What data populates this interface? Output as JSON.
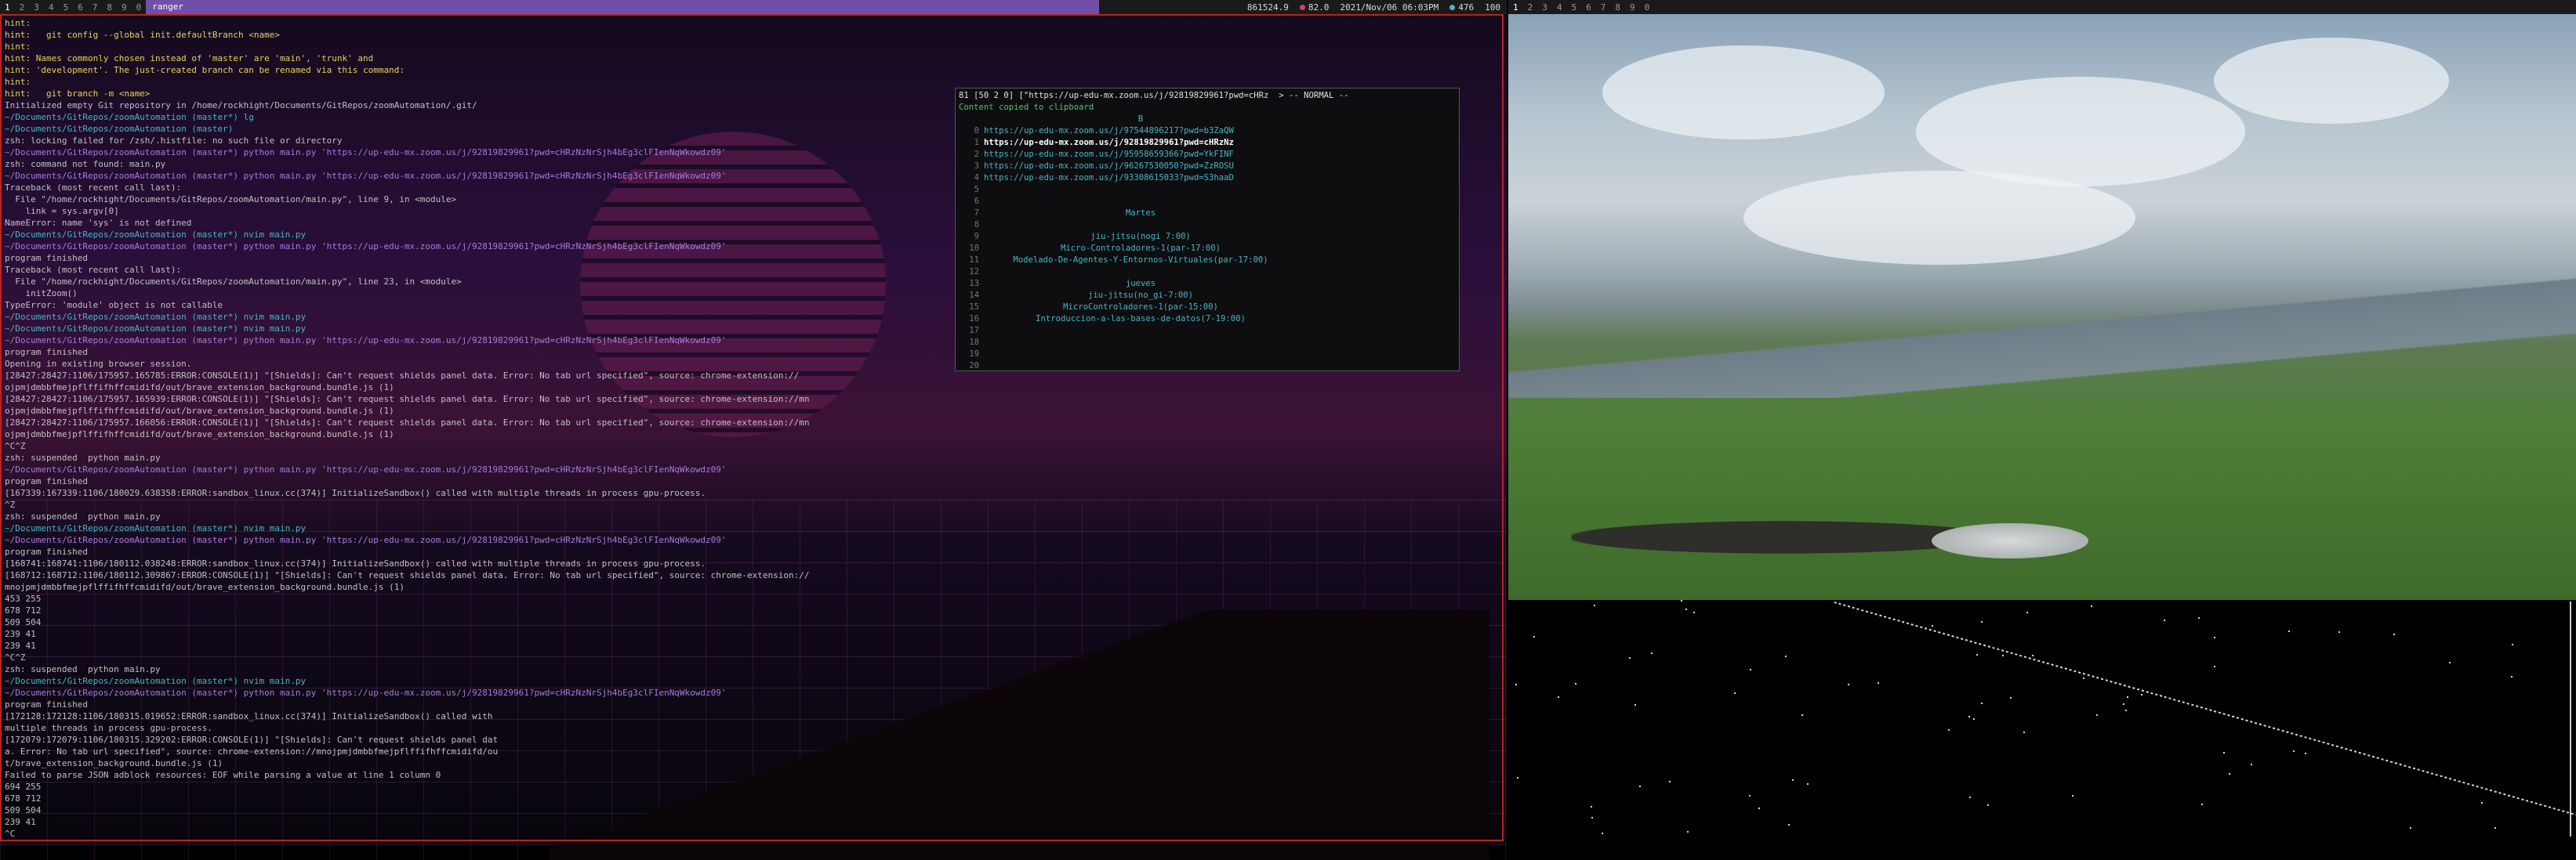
{
  "topbar_left": {
    "workspaces": [
      "1",
      "2",
      "3",
      "4",
      "5",
      "6",
      "7",
      "8",
      "9",
      "0"
    ],
    "window_title": "ranger",
    "status": [
      {
        "label": "861524.9"
      },
      {
        "label": "82.0"
      },
      {
        "label": "2021/Nov/06 06:03PM"
      },
      {
        "label": "476"
      },
      {
        "label": "100"
      }
    ]
  },
  "topbar_right": {
    "workspaces": [
      "1",
      "2",
      "3",
      "4",
      "5",
      "6",
      "7",
      "8",
      "9",
      "0"
    ]
  },
  "terminal": {
    "lines": [
      {
        "text": "hint:",
        "color": "yellow"
      },
      {
        "text": "hint:   git config --global init.defaultBranch <name>",
        "color": "yellow"
      },
      {
        "text": "hint:",
        "color": "yellow"
      },
      {
        "text": "hint: Names commonly chosen instead of 'master' are 'main', 'trunk' and",
        "color": "yellow"
      },
      {
        "text": "hint: 'development'. The just-created branch can be renamed via this command:",
        "color": "yellow"
      },
      {
        "text": "hint:",
        "color": "yellow"
      },
      {
        "text": "hint:   git branch -m <name>",
        "color": "yellow"
      },
      {
        "text": "Initialized empty Git repository in /home/rockhight/Documents/GitRepos/zoomAutomation/.git/",
        "color": "dim"
      },
      {
        "text": "~/Documents/GitRepos/zoomAutomation (master*) lg",
        "color": "teal"
      },
      {
        "text": "~/Documents/GitRepos/zoomAutomation (master)",
        "color": "teal"
      },
      {
        "text": "zsh: locking failed for /zsh/.histfile: no such file or directory",
        "color": "dim"
      },
      {
        "text": "~/Documents/GitRepos/zoomAutomation (master*) python main.py 'https://up-edu-mx.zoom.us/j/92819829961?pwd=cHRzNzNrSjh4bEg3clFIenNqWkowdz09'",
        "color": "purple"
      },
      {
        "text": "zsh: command not found: main.py",
        "color": "dim"
      },
      {
        "text": "~/Documents/GitRepos/zoomAutomation (master*) python main.py 'https://up-edu-mx.zoom.us/j/92819829961?pwd=cHRzNzNrSjh4bEg3clFIenNqWkowdz09'",
        "color": "purple"
      },
      {
        "text": "Traceback (most recent call last):",
        "color": "dim"
      },
      {
        "text": "  File \"/home/rockhight/Documents/GitRepos/zoomAutomation/main.py\", line 9, in <module>",
        "color": "dim"
      },
      {
        "text": "    link = sys.argv[0]",
        "color": "dim"
      },
      {
        "text": "NameError: name 'sys' is not defined",
        "color": "dim"
      },
      {
        "text": "~/Documents/GitRepos/zoomAutomation (master*) nvim main.py",
        "color": "teal"
      },
      {
        "text": "~/Documents/GitRepos/zoomAutomation (master*) python main.py 'https://up-edu-mx.zoom.us/j/92819829961?pwd=cHRzNzNrSjh4bEg3clFIenNqWkowdz09'",
        "color": "purple"
      },
      {
        "text": "program finished",
        "color": "dim"
      },
      {
        "text": "Traceback (most recent call last):",
        "color": "dim"
      },
      {
        "text": "  File \"/home/rockhight/Documents/GitRepos/zoomAutomation/main.py\", line 23, in <module>",
        "color": "dim"
      },
      {
        "text": "    initZoom()",
        "color": "dim"
      },
      {
        "text": "TypeError: 'module' object is not callable",
        "color": "dim"
      },
      {
        "text": "~/Documents/GitRepos/zoomAutomation (master*) nvim main.py",
        "color": "teal"
      },
      {
        "text": "~/Documents/GitRepos/zoomAutomation (master*) nvim main.py",
        "color": "teal"
      },
      {
        "text": "~/Documents/GitRepos/zoomAutomation (master*) python main.py 'https://up-edu-mx.zoom.us/j/92819829961?pwd=cHRzNzNrSjh4bEg3clFIenNqWkowdz09'",
        "color": "purple"
      },
      {
        "text": "program finished",
        "color": "dim"
      },
      {
        "text": "Opening in existing browser session.",
        "color": "dim"
      },
      {
        "text": "[28427:28427:1106/175957.165785:ERROR:CONSOLE(1)] \"[Shields]: Can't request shields panel data. Error: No tab url specified\", source: chrome-extension://",
        "color": "dim"
      },
      {
        "text": "ojpmjdmbbfmejpflffifhffcmidifd/out/brave_extension_background.bundle.js (1)",
        "color": "dim"
      },
      {
        "text": "[28427:28427:1106/175957.165939:ERROR:CONSOLE(1)] \"[Shields]: Can't request shields panel data. Error: No tab url specified\", source: chrome-extension://mn",
        "color": "dim"
      },
      {
        "text": "ojpmjdmbbfmejpflffifhffcmidifd/out/brave_extension_background.bundle.js (1)",
        "color": "dim"
      },
      {
        "text": "[28427:28427:1106/175957.166056:ERROR:CONSOLE(1)] \"[Shields]: Can't request shields panel data. Error: No tab url specified\", source: chrome-extension://mn",
        "color": "dim"
      },
      {
        "text": "ojpmjdmbbfmejpflffifhffcmidifd/out/brave_extension_background.bundle.js (1)",
        "color": "dim"
      },
      {
        "text": "^C^Z",
        "color": "dim"
      },
      {
        "text": "zsh: suspended  python main.py",
        "color": "dim"
      },
      {
        "text": "~/Documents/GitRepos/zoomAutomation (master*) python main.py 'https://up-edu-mx.zoom.us/j/92819829961?pwd=cHRzNzNrSjh4bEg3clFIenNqWkowdz09'",
        "color": "purple"
      },
      {
        "text": "program finished",
        "color": "dim"
      },
      {
        "text": "[167339:167339:1106/180029.638358:ERROR:sandbox_linux.cc(374)] InitializeSandbox() called with multiple threads in process gpu-process.",
        "color": "dim"
      },
      {
        "text": "^Z",
        "color": "dim"
      },
      {
        "text": "zsh: suspended  python main.py",
        "color": "dim"
      },
      {
        "text": "~/Documents/GitRepos/zoomAutomation (master*) nvim main.py",
        "color": "teal"
      },
      {
        "text": "~/Documents/GitRepos/zoomAutomation (master*) python main.py 'https://up-edu-mx.zoom.us/j/92819829961?pwd=cHRzNzNrSjh4bEg3clFIenNqWkowdz09'",
        "color": "purple"
      },
      {
        "text": "program finished",
        "color": "dim"
      },
      {
        "text": "[168741:168741:1106/180112.038248:ERROR:sandbox_linux.cc(374)] InitializeSandbox() called with multiple threads in process gpu-process.",
        "color": "dim"
      },
      {
        "text": "[168712:168712:1106/180112.309867:ERROR:CONSOLE(1)] \"[Shields]: Can't request shields panel data. Error: No tab url specified\", source: chrome-extension://",
        "color": "dim"
      },
      {
        "text": "mnojpmjdmbbfmejpflffifhffcmidifd/out/brave_extension_background.bundle.js (1)",
        "color": "dim"
      },
      {
        "text": "453 255",
        "color": "dim"
      },
      {
        "text": "678 712",
        "color": "dim"
      },
      {
        "text": "509 504",
        "color": "dim"
      },
      {
        "text": "239 41",
        "color": "dim"
      },
      {
        "text": "239 41",
        "color": "dim"
      },
      {
        "text": "^C^Z",
        "color": "dim"
      },
      {
        "text": "zsh: suspended  python main.py",
        "color": "dim"
      },
      {
        "text": "~/Documents/GitRepos/zoomAutomation (master*) nvim main.py",
        "color": "teal"
      },
      {
        "text": "~/Documents/GitRepos/zoomAutomation (master*) python main.py 'https://up-edu-mx.zoom.us/j/92819829961?pwd=cHRzNzNrSjh4bEg3clFIenNqWkowdz09'",
        "color": "purple"
      },
      {
        "text": "program finished",
        "color": "dim"
      },
      {
        "text": "[172128:172128:1106/180315.019652:ERROR:sandbox_linux.cc(374)] InitializeSandbox() called with",
        "color": "dim"
      },
      {
        "text": "multiple threads in process gpu-process.",
        "color": "dim"
      },
      {
        "text": "[172079:172079:1106/180315.329202:ERROR:CONSOLE(1)] \"[Shields]: Can't request shields panel dat",
        "color": "dim"
      },
      {
        "text": "a. Error: No tab url specified\", source: chrome-extension://mnojpmjdmbbfmejpflffifhffcmidifd/ou",
        "color": "dim"
      },
      {
        "text": "t/brave_extension_background.bundle.js (1)",
        "color": "dim"
      },
      {
        "text": "Failed to parse JSON adblock resources: EOF while parsing a value at line 1 column 0",
        "color": "dim"
      },
      {
        "text": "694 255",
        "color": "dim"
      },
      {
        "text": "678 712",
        "color": "dim"
      },
      {
        "text": "509 504",
        "color": "dim"
      },
      {
        "text": "239 41",
        "color": "dim"
      },
      {
        "text": "^C",
        "color": "dim"
      }
    ]
  },
  "floating": {
    "header": "81 [50 2 0] [\"https://up-edu-mx.zoom.us/j/92819829961?pwd=cHRz  > -- NORMAL --",
    "message": "Content copied to clipboard",
    "rows": [
      {
        "num": "",
        "text": "B",
        "style": "center"
      },
      {
        "num": "0",
        "text": "https://up-edu-mx.zoom.us/j/97544896217?pwd=b3ZaQW",
        "style": "url"
      },
      {
        "num": "1",
        "text": "https://up-edu-mx.zoom.us/j/92819829961?pwd=cHRzNz",
        "style": "sel"
      },
      {
        "num": "2",
        "text": "https://up-edu-mx.zoom.us/j/95958659366?pwd=YkFINF",
        "style": "url"
      },
      {
        "num": "3",
        "text": "https://up-edu-mx.zoom.us/j/96267530050?pwd=ZzROSU",
        "style": "url"
      },
      {
        "num": "4",
        "text": "https://up-edu-mx.zoom.us/j/93308615033?pwd=S3haaD",
        "style": "url"
      },
      {
        "num": "5",
        "text": "",
        "style": "url"
      },
      {
        "num": "6",
        "text": "",
        "style": "url"
      },
      {
        "num": "7",
        "text": "Martes",
        "style": "center"
      },
      {
        "num": "8",
        "text": "",
        "style": "url"
      },
      {
        "num": "9",
        "text": "jiu-jitsu(nogi 7:00)",
        "style": "center"
      },
      {
        "num": "10",
        "text": "Micro-Controladores-1(par-17:00)",
        "style": "center"
      },
      {
        "num": "11",
        "text": "Modelado-De-Agentes-Y-Entornos-Virtuales(par-17:00)",
        "style": "center"
      },
      {
        "num": "12",
        "text": "",
        "style": "url"
      },
      {
        "num": "13",
        "text": "jueves",
        "style": "center"
      },
      {
        "num": "14",
        "text": "jiu-jitsu(no_gi-7:00)",
        "style": "center"
      },
      {
        "num": "15",
        "text": "MicroControladores-1(par-15:00)",
        "style": "center"
      },
      {
        "num": "16",
        "text": "Introduccion-a-las-bases-de-datos(7-19:00)",
        "style": "center"
      },
      {
        "num": "17",
        "text": "",
        "style": "url"
      },
      {
        "num": "18",
        "text": "",
        "style": "url"
      },
      {
        "num": "19",
        "text": "",
        "style": "url"
      },
      {
        "num": "20",
        "text": "",
        "style": "url"
      }
    ]
  },
  "colors": {
    "accent": "#6f4fa8",
    "focused_border": "#bb2222",
    "prompt_path": "#46b6c4",
    "branch": "#e6d35a",
    "command": "#a77bdc"
  }
}
